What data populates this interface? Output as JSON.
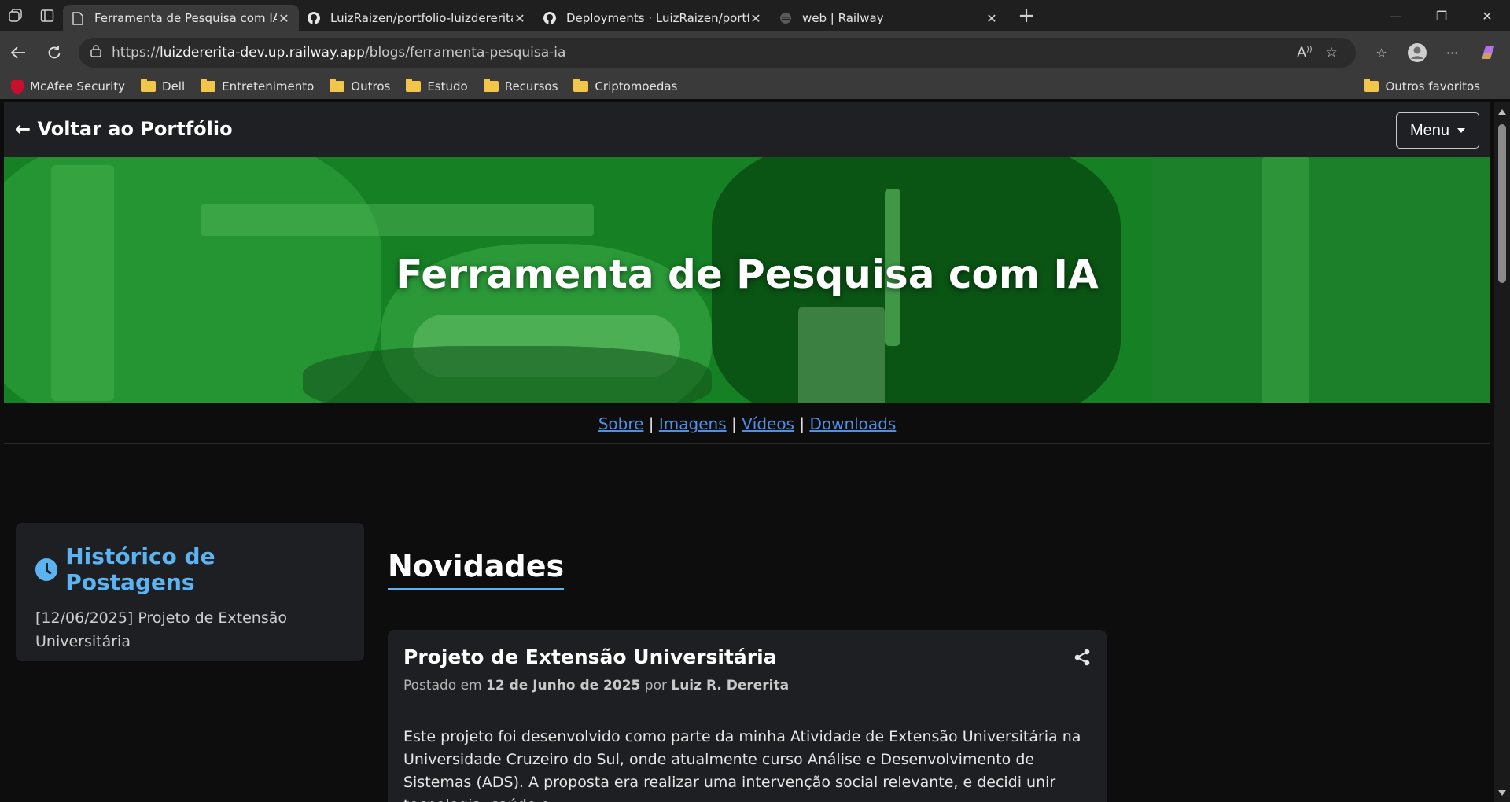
{
  "browser": {
    "tabs": [
      {
        "title": "Ferramenta de Pesquisa com IA | L",
        "icon": "page-icon",
        "active": true
      },
      {
        "title": "LuizRaizen/portfolio-luizdererita-d",
        "icon": "github-icon",
        "active": false
      },
      {
        "title": "Deployments · LuizRaizen/portfoli",
        "icon": "github-icon",
        "active": false
      },
      {
        "title": "web | Railway",
        "icon": "railway-icon",
        "active": false
      }
    ],
    "url_prefix": "https://",
    "url_host": "luizdererita-dev.up.railway.app",
    "url_path": "/blogs/ferramenta-pesquisa-ia",
    "bookmarks": [
      "McAfee Security",
      "Dell",
      "Entretenimento",
      "Outros",
      "Estudo",
      "Recursos",
      "Criptomoedas"
    ],
    "other_favorites": "Outros favoritos"
  },
  "site": {
    "back_label": "← Voltar ao Portfólio",
    "menu_label": "Menu",
    "hero_title": "Ferramenta de Pesquisa com IA",
    "subnav": [
      "Sobre",
      "Imagens",
      "Vídeos",
      "Downloads"
    ],
    "subnav_separator": "|",
    "history": {
      "title": "Histórico de Postagens",
      "entries": [
        "[12/06/2025] Projeto de Extensão Universitária"
      ]
    },
    "news_title": "Novidades",
    "post": {
      "title": "Projeto de Extensão Universitária",
      "posted_prefix": "Postado em",
      "date": "12 de Junho de 2025",
      "by": "por",
      "author": "Luiz R. Dererita",
      "body": "Este projeto foi desenvolvido como parte da minha Atividade de Extensão Universitária na Universidade Cruzeiro do Sul, onde atualmente curso Análise e Desenvolvimento de Sistemas (ADS). A proposta era realizar uma intervenção social relevante, e decidi unir tecnologia, saúde e"
    }
  },
  "colors": {
    "accent": "#5cb3f2",
    "link": "#4e8fe8",
    "hero_green": "#1c8f2a",
    "card_bg": "#1e1f22",
    "page_bg": "#0d0d0d"
  }
}
